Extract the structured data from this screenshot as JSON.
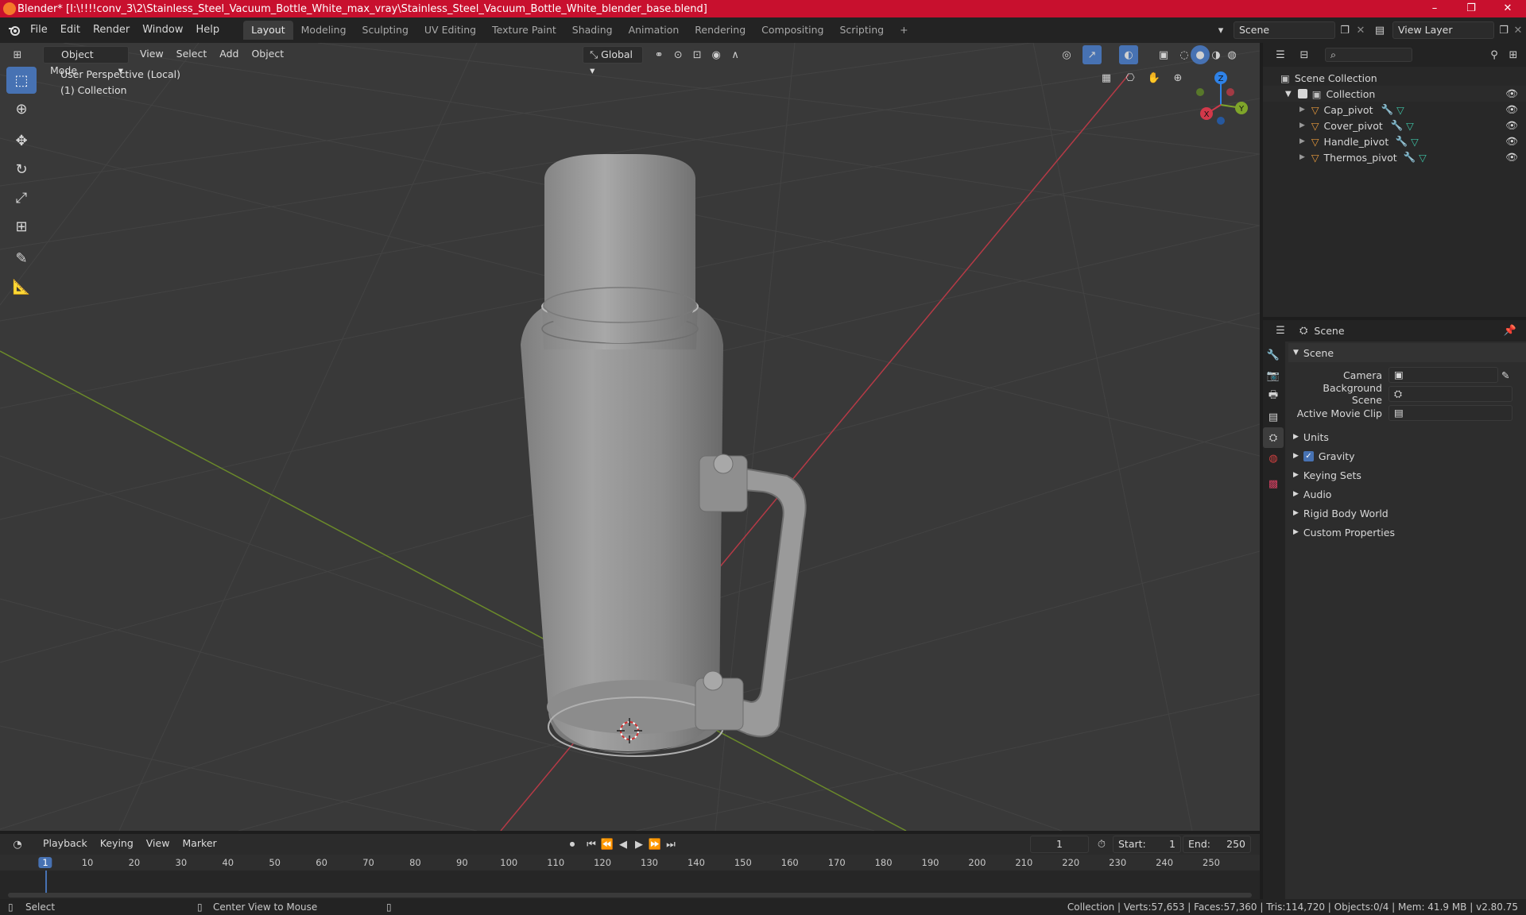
{
  "window": {
    "title": "Blender* [I:\\!!!!conv_3\\2\\Stainless_Steel_Vacuum_Bottle_White_max_vray\\Stainless_Steel_Vacuum_Bottle_White_blender_base.blend]",
    "minimize": "–",
    "maximize": "❐",
    "close": "✕"
  },
  "menu": [
    "File",
    "Edit",
    "Render",
    "Window",
    "Help"
  ],
  "workspaces": [
    "Layout",
    "Modeling",
    "Sculpting",
    "UV Editing",
    "Texture Paint",
    "Shading",
    "Animation",
    "Rendering",
    "Compositing",
    "Scripting"
  ],
  "workspace_add": "+",
  "scene_field": "Scene",
  "view_layer_field": "View Layer",
  "viewport": {
    "mode": "Object Mode",
    "menus": [
      "View",
      "Select",
      "Add",
      "Object"
    ],
    "orientation": "Global",
    "overlay_line1": "User Perspective (Local)",
    "overlay_line2": "(1) Collection",
    "gizmo": {
      "x": "X",
      "y": "Y",
      "z": "Z"
    }
  },
  "outliner": {
    "root": "Scene Collection",
    "collection": "Collection",
    "objects": [
      "Cap_pivot",
      "Cover_pivot",
      "Handle_pivot",
      "Thermos_pivot"
    ]
  },
  "properties": {
    "header": "Scene",
    "panel_title": "Scene",
    "fields": {
      "camera_label": "Camera",
      "background_scene_label": "Background Scene",
      "active_movie_clip_label": "Active Movie Clip"
    },
    "subpanels": [
      "Units",
      "Gravity",
      "Keying Sets",
      "Audio",
      "Rigid Body World",
      "Custom Properties"
    ],
    "gravity_checked": true
  },
  "timeline": {
    "menus": [
      "Playback",
      "Keying",
      "View",
      "Marker"
    ],
    "current_frame": "1",
    "start_label": "Start:",
    "start": "1",
    "end_label": "End:",
    "end": "250",
    "ticks": [
      "1",
      "10",
      "20",
      "30",
      "40",
      "50",
      "60",
      "70",
      "80",
      "90",
      "100",
      "110",
      "120",
      "130",
      "140",
      "150",
      "160",
      "170",
      "180",
      "190",
      "200",
      "210",
      "220",
      "230",
      "240",
      "250"
    ]
  },
  "status": {
    "left_action": "Select",
    "middle_action": "Center View to Mouse",
    "stats": "Collection | Verts:57,653 | Faces:57,360 | Tris:114,720 | Objects:0/4 | Mem: 41.9 MB | v2.80.75"
  },
  "colors": {
    "title_bar": "#c8102e",
    "accent": "#4772b3",
    "axis_x": "#d2384a",
    "axis_y": "#7fa52a",
    "axis_z": "#2e82e8",
    "object_orange": "#e89a3c"
  }
}
